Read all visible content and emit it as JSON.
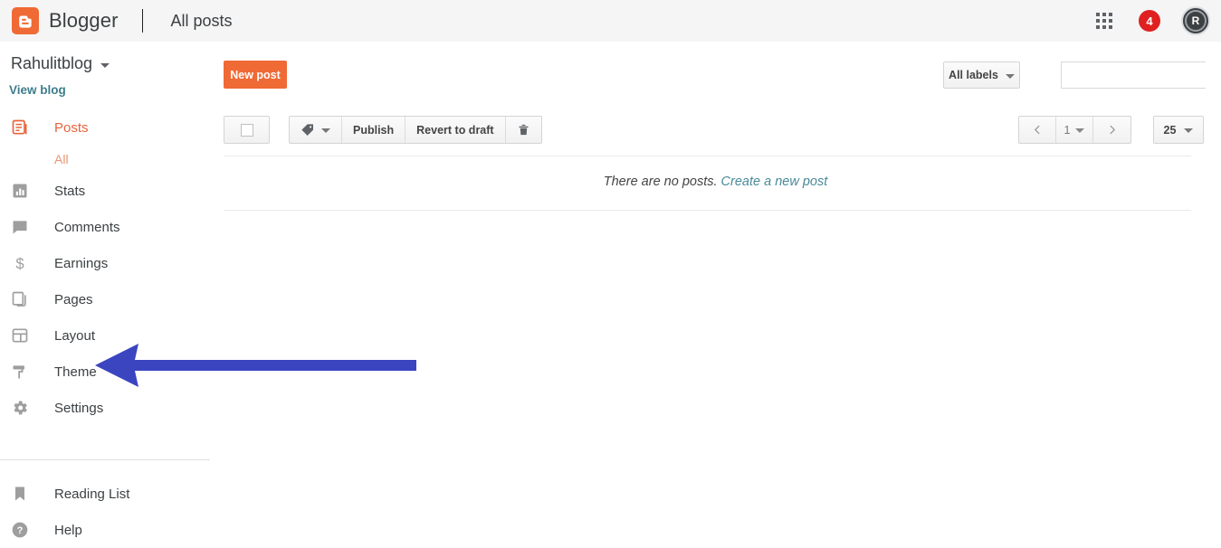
{
  "topbar": {
    "logo_icon": "blogger-logo-icon",
    "brand": "Blogger",
    "page_title": "All posts",
    "apps_icon": "apps-grid-icon",
    "notification_count": "4",
    "avatar_initial": "R",
    "logo_color": "#f06a35"
  },
  "sidebar": {
    "blog_name": "Rahulitblog",
    "blog_switcher_icon": "chevron-down-icon",
    "view_blog_label": "View blog",
    "active_color": "#e8643c",
    "items": [
      {
        "label": "Posts",
        "icon": "posts-icon",
        "active": true
      },
      {
        "label": "Stats",
        "icon": "stats-bar-chart-icon",
        "active": false
      },
      {
        "label": "Comments",
        "icon": "comment-bubble-icon",
        "active": false
      },
      {
        "label": "Earnings",
        "icon": "dollar-sign-icon",
        "active": false
      },
      {
        "label": "Pages",
        "icon": "pages-icon",
        "active": false
      },
      {
        "label": "Layout",
        "icon": "layout-icon",
        "active": false
      },
      {
        "label": "Theme",
        "icon": "paint-roller-icon",
        "active": false
      },
      {
        "label": "Settings",
        "icon": "gear-icon",
        "active": false
      }
    ],
    "sub_item": "All",
    "footer_items": [
      {
        "label": "Reading List",
        "icon": "bookmark-icon"
      },
      {
        "label": "Help",
        "icon": "help-circle-icon"
      }
    ]
  },
  "main": {
    "new_post_label": "New post",
    "new_post_color": "#f06a35",
    "labels_filter_label": "All labels",
    "labels_filter_icon": "chevron-down-icon",
    "search": {
      "value": "",
      "placeholder": "",
      "icon": "search-icon"
    },
    "toolbar": {
      "select_all_icon": "checkbox-unchecked-icon",
      "label_tag_icon": "tag-icon",
      "label_tag_caret": "chevron-down-icon",
      "publish_label": "Publish",
      "revert_label": "Revert to draft",
      "delete_icon": "trash-icon"
    },
    "pagination": {
      "prev_icon": "chevron-left-icon",
      "page_number": "1",
      "page_caret": "chevron-down-icon",
      "next_icon": "chevron-right-icon",
      "per_page": "25",
      "per_page_caret": "chevron-down-icon"
    },
    "empty_state": {
      "message": "There are no posts.",
      "link_label": "Create a new post",
      "link_color": "#4a8a98"
    }
  },
  "annotation": {
    "type": "arrow",
    "points_to": "Theme",
    "direction": "left",
    "color": "#3b45c0"
  }
}
